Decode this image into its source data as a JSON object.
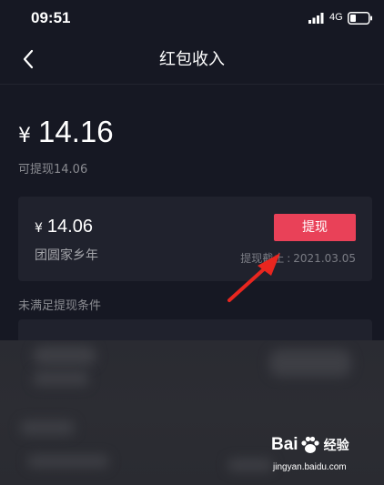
{
  "status_bar": {
    "time": "09:51",
    "network": "4G",
    "icons": [
      "signal-icon",
      "battery-icon"
    ]
  },
  "nav": {
    "back_icon": "chevron-left-icon",
    "title": "红包收入"
  },
  "balance": {
    "currency": "¥",
    "amount": "14.16",
    "withdrawable": "可提现14.06"
  },
  "card": {
    "currency": "¥",
    "amount": "14.06",
    "name": "团圆家乡年",
    "button_label": "提现",
    "deadline_label": "提现截止",
    "deadline_sep": ":",
    "deadline_date": "2021.03.05"
  },
  "unmet_section": {
    "label": "未满足提现条件"
  },
  "watermark": {
    "logo_left": "Bai",
    "logo_right": "经验",
    "url": "jingyan.baidu.com"
  },
  "colors": {
    "background": "#161823",
    "card": "#20222d",
    "accent": "#e94158",
    "annotation_arrow": "#e8261f"
  }
}
